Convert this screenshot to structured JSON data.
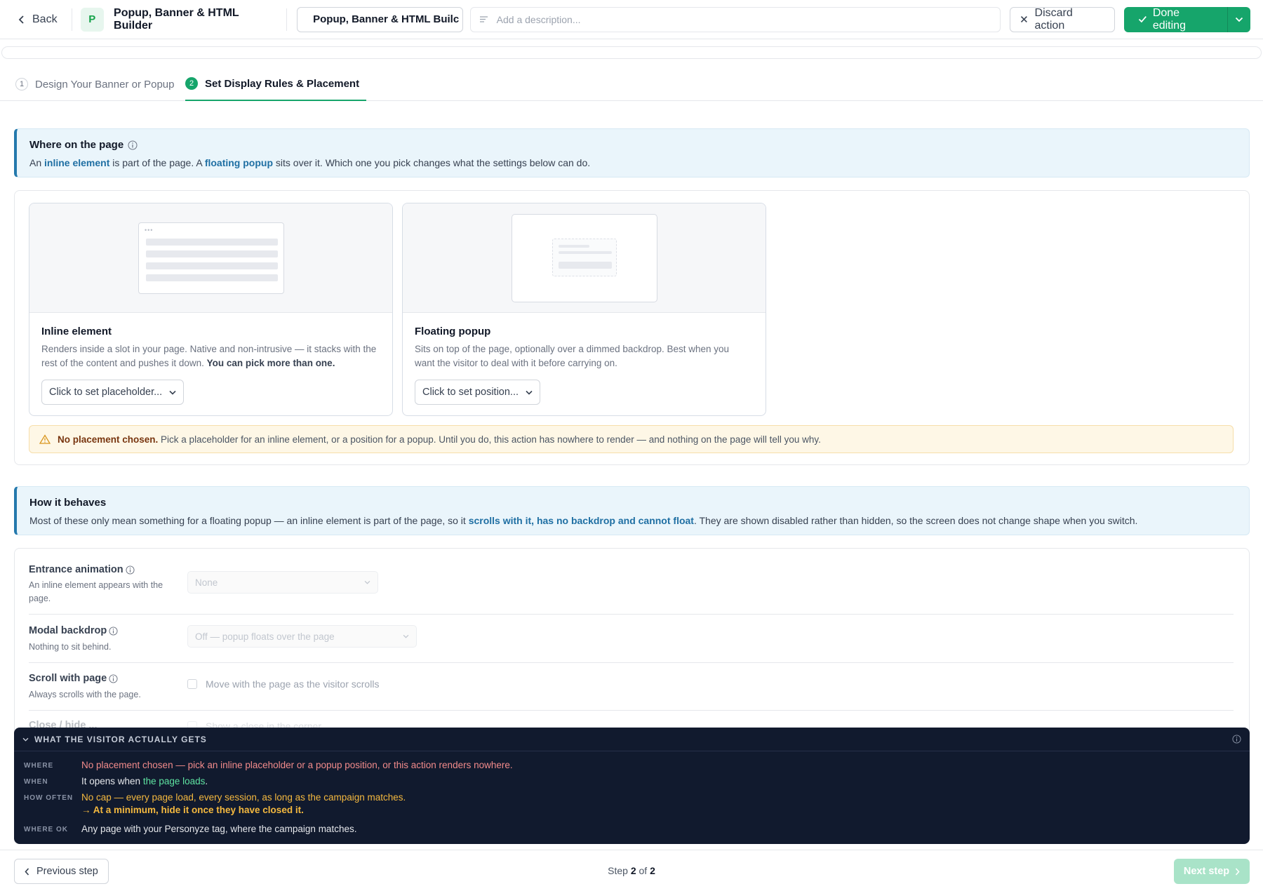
{
  "header": {
    "back_label": "Back",
    "app_badge": "P",
    "app_title": "Popup, Banner & HTML Builder",
    "name_value": "Popup, Banner & HTML Builc",
    "description_placeholder": "Add a description...",
    "discard_label": "Discard action",
    "done_label": "Done editing"
  },
  "steps": [
    {
      "number": "1",
      "label": "Design Your Banner or Popup",
      "active": false
    },
    {
      "number": "2",
      "label": "Set Display Rules & Placement",
      "active": true
    }
  ],
  "where": {
    "title": "Where on the page",
    "text_a": "An ",
    "text_b": "inline element",
    "text_c": " is part of the page. A ",
    "text_d": "floating popup",
    "text_e": " sits over it. Which one you pick changes what the settings below can do."
  },
  "inline_card": {
    "title": "Inline element",
    "desc": "Renders inside a slot in your page. Native and non-intrusive — it stacks with the rest of the content and pushes it down. ",
    "desc_bold": "You can pick more than one.",
    "select_label": "Click to set placeholder..."
  },
  "popup_card": {
    "title": "Floating popup",
    "desc": "Sits on top of the page, optionally over a dimmed backdrop. Best when you want the visitor to deal with it before carrying on.",
    "select_label": "Click to set position..."
  },
  "warning": {
    "bold": "No placement chosen.",
    "text": " Pick a placeholder for an inline element, or a position for a popup. Until you do, this action has nowhere to render — and nothing on the page will tell you why."
  },
  "behaves": {
    "title": "How it behaves",
    "text_a": "Most of these only mean something for a floating popup — an inline element is part of the page, so it ",
    "text_b": "scrolls with it, has no backdrop and cannot float",
    "text_c": ". They are shown disabled rather than hidden, so the screen does not change shape when you switch."
  },
  "settings": {
    "entrance": {
      "label": "Entrance animation",
      "sub": "An inline element appears with the page.",
      "value": "None"
    },
    "backdrop": {
      "label": "Modal backdrop",
      "sub": "Nothing to sit behind.",
      "value": "Off — popup floats over the page"
    },
    "scroll": {
      "label": "Scroll with page",
      "sub": "Always scrolls with the page.",
      "checkbox": "Move with the page as the visitor scrolls"
    },
    "partial": {
      "label": "Close / hide ...",
      "checkbox": "Show a close in the corner"
    }
  },
  "visitor": {
    "header": "WHAT THE VISITOR ACTUALLY GETS",
    "where_key": "WHERE",
    "where_val": "No placement chosen — pick an inline placeholder or a popup position, or this action renders nowhere.",
    "when_key": "WHEN",
    "when_val_a": "It opens when ",
    "when_val_b": "the page loads",
    "when_val_c": ".",
    "often_key": "HOW OFTEN",
    "often_val": "No cap — every page load, every session, as long as the campaign matches.",
    "often_hint": "→ At a minimum, hide it once they have closed it.",
    "whereok_key": "WHERE OK",
    "whereok_val": "Any page with your Personyze tag, where the campaign matches."
  },
  "footer": {
    "prev_label": "Previous step",
    "step_a": "Step ",
    "step_current": "2",
    "step_b": " of ",
    "step_total": "2",
    "next_label": "Next step"
  },
  "colors": {
    "accent": "#16a56b",
    "info": "#2479ad",
    "warning_bg": "#fef7e6",
    "dark_panel": "#111a2e"
  }
}
